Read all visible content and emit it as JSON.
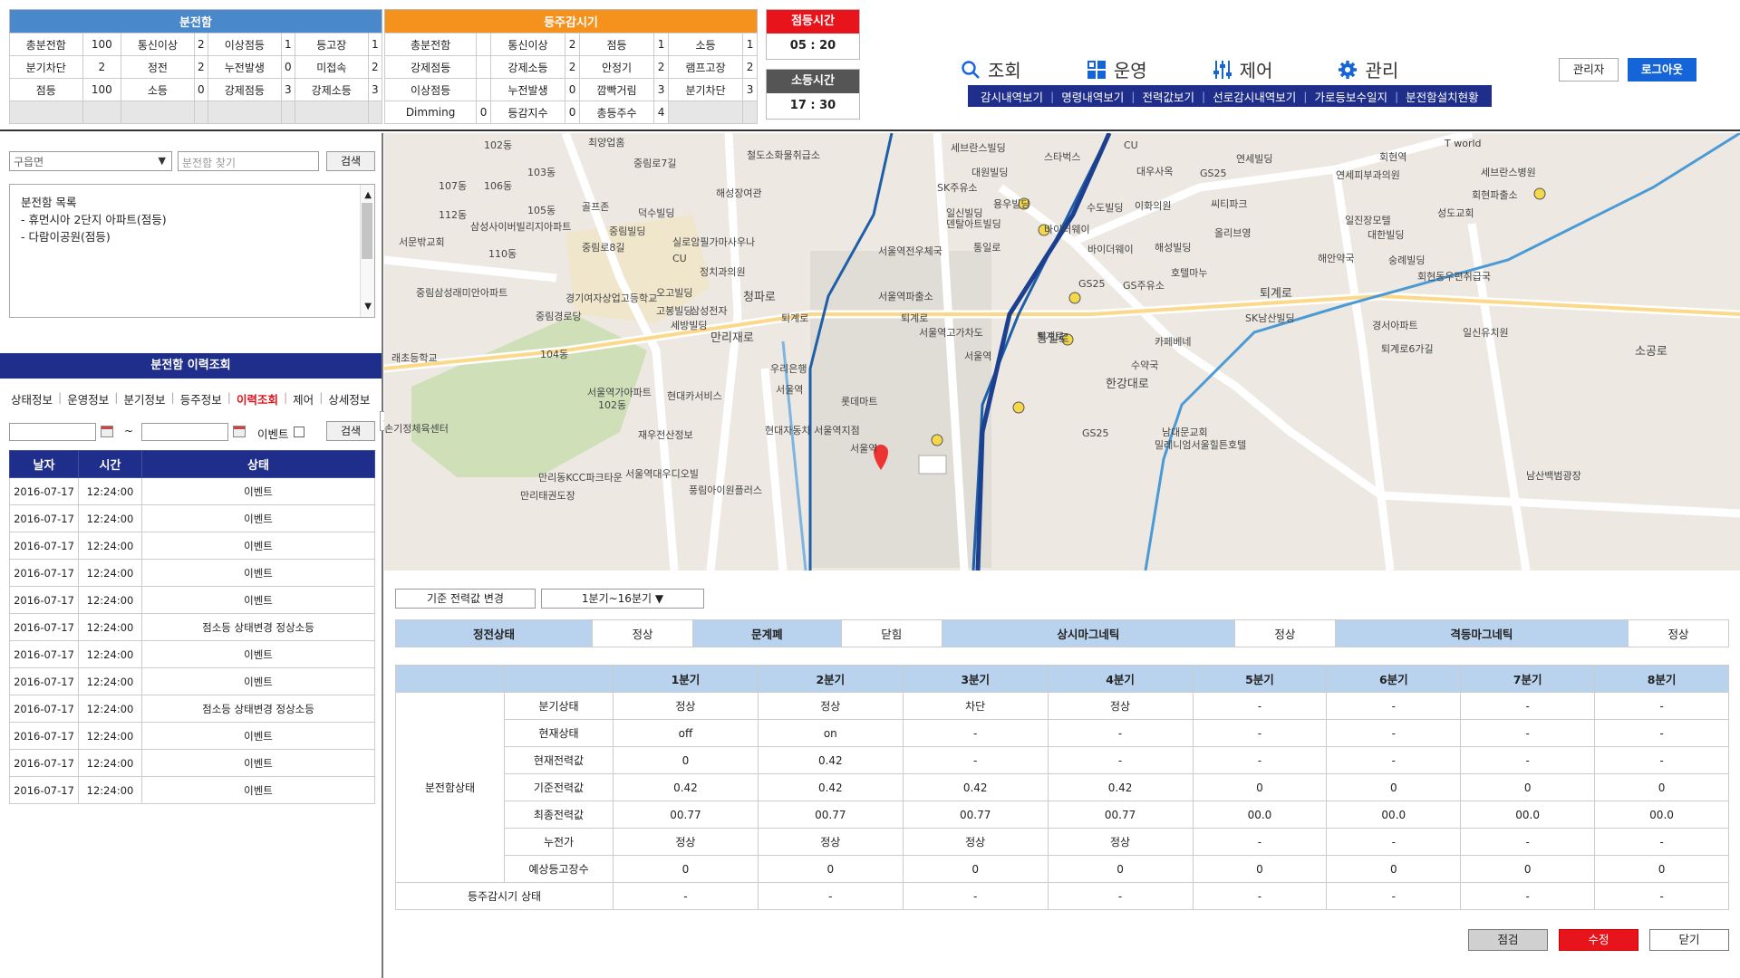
{
  "board_summary": {
    "title": "분전함",
    "rows": [
      [
        "총분전함",
        "100",
        "통신이상",
        "2",
        "이상점등",
        "1",
        "등고장",
        "1"
      ],
      [
        "분기차단",
        "2",
        "정전",
        "2",
        "누전발생",
        "0",
        "미접속",
        "2"
      ],
      [
        "점등",
        "100",
        "소등",
        "0",
        "강제점등",
        "3",
        "강제소등",
        "3"
      ],
      [
        "",
        "",
        "",
        "",
        "",
        "",
        "",
        ""
      ]
    ]
  },
  "monitor_summary": {
    "title": "등주감시기",
    "rows": [
      [
        "총분전함",
        "",
        "통신이상",
        "2",
        "점등",
        "1",
        "소등",
        "1"
      ],
      [
        "강제점등",
        "",
        "강제소등",
        "2",
        "안정기",
        "2",
        "램프고장",
        "2"
      ],
      [
        "이상점등",
        "",
        "누전발생",
        "0",
        "깜빡거림",
        "3",
        "분기차단",
        "3"
      ],
      [
        "Dimming",
        "0",
        "등감지수",
        "0",
        "총등주수",
        "4",
        "",
        ""
      ]
    ]
  },
  "on_time": {
    "label": "점등시간",
    "value": "05 : 20"
  },
  "off_time": {
    "label": "소등시간",
    "value": "17 : 30"
  },
  "nav": [
    {
      "label": "조회",
      "icon": "search-icon"
    },
    {
      "label": "운영",
      "icon": "grid-icon"
    },
    {
      "label": "제어",
      "icon": "sliders-icon"
    },
    {
      "label": "관리",
      "icon": "gear-icon"
    }
  ],
  "subnav": [
    "감시내역보기",
    "명령내역보기",
    "전력값보기",
    "선로감시내역보기",
    "가로등보수일지",
    "분전함설치현황"
  ],
  "admin_label": "관리자",
  "logout_label": "로그아웃",
  "left": {
    "district_placeholder": "구읍면",
    "search_placeholder": "분전함 찾기",
    "search_label": "검색",
    "list_title": "분전함 목록",
    "list_items": [
      "- 휴먼시아 2단지 아파트(점등)",
      "- 다람이공원(점등)"
    ],
    "history_title": "분전함 이력조회",
    "tabs": [
      "상태정보",
      "운영정보",
      "분기정보",
      "등주정보",
      "이력조회",
      "제어",
      "상세정보"
    ],
    "tilde": "~",
    "event_label": "이벤트",
    "history_search_label": "검색",
    "history_headers": [
      "날자",
      "시간",
      "상태"
    ],
    "history_rows": [
      [
        "2016-07-17",
        "12:24:00",
        "이벤트"
      ],
      [
        "2016-07-17",
        "12:24:00",
        "이벤트"
      ],
      [
        "2016-07-17",
        "12:24:00",
        "이벤트"
      ],
      [
        "2016-07-17",
        "12:24:00",
        "이벤트"
      ],
      [
        "2016-07-17",
        "12:24:00",
        "이벤트"
      ],
      [
        "2016-07-17",
        "12:24:00",
        "점소등 상태변경 정상소등"
      ],
      [
        "2016-07-17",
        "12:24:00",
        "이벤트"
      ],
      [
        "2016-07-17",
        "12:24:00",
        "이벤트"
      ],
      [
        "2016-07-17",
        "12:24:00",
        "점소등 상태변경 정상소등"
      ],
      [
        "2016-07-17",
        "12:24:00",
        "이벤트"
      ],
      [
        "2016-07-17",
        "12:24:00",
        "이벤트"
      ],
      [
        "2016-07-17",
        "12:24:00",
        "이벤트"
      ]
    ]
  },
  "map_labels": {
    "l1": "최양업홈",
    "l2": "철도소화물취급소",
    "l3": "세브란스빌딩",
    "l4": "스타벅스",
    "l5": "CU",
    "l6": "연세빌딩",
    "l7": "회현역",
    "l8": "T world",
    "l9": "세브란스병원",
    "l10": "102동",
    "l11": "103동",
    "l12": "중림로7길",
    "l13": "해성장여관",
    "l14": "대원빌딩",
    "l15": "SK주유소",
    "l16": "대우사옥",
    "l17": "GS25",
    "l18": "연세피부과의원",
    "l19": "세원면세점",
    "l20": "107동",
    "l21": "106동",
    "l22": "골프존",
    "l23": "덕수빌딩",
    "l24": "CU",
    "l25": "일신빌딩",
    "l26": "용우빌딩",
    "l27": "수도빌딩",
    "l28": "이화의원",
    "l29": "씨티파크",
    "l30": "회현파출소",
    "l31": "112동",
    "l32": "삼성사이버빌리지아파트",
    "l33": "105동",
    "l34": "중림빌딩",
    "l35": "실로암필가마사우나",
    "l36": "덴탈아트빌딩",
    "l37": "바이더웨이",
    "l38": "올리브영",
    "l39": "일진장모텔",
    "l40": "서문밖교회",
    "l41": "110동",
    "l42": "중림로8길",
    "l43": "서울역전우체국",
    "l44": "통일로",
    "l45": "바이더웨이",
    "l46": "해성빌딩",
    "l47": "대한빌딩",
    "l48": "성도교회",
    "l49": "CU",
    "l50": "정치과의원",
    "l51": "중림삼성래미안아파트",
    "l52": "경기여자상업고등학교",
    "l53": "오고빌딩",
    "l54": "서울역파출소",
    "l55": "GS25",
    "l56": "GS주유소",
    "l57": "호텔마누",
    "l58": "해안약국",
    "l59": "숭례빌딩",
    "l60": "회현동우편취급국",
    "l61": "중림경로당",
    "l62": "고봉빌딩",
    "l63": "삼성전자",
    "l64": "세방빌딩",
    "l65": "퇴계로",
    "l66": "퇴계로",
    "l67": "서울역고가차도",
    "l68": "SK남산빌딩",
    "l69": "경서아파트",
    "l70": "일신유치원",
    "l71": "래초등학교",
    "l72": "104동",
    "l73": "퇴계로",
    "l74": "카페베네",
    "l75": "서울역",
    "l76": "우리은행",
    "l77": "수약국",
    "l78": "퇴계로6가길",
    "l79": "서울역",
    "l80": "롯데마트",
    "l81": "서울역가아파트",
    "l82": "102동",
    "l83": "현대카서비스",
    "l84": "현대자동차 서울역지점",
    "l85": "손기정체육센터",
    "l86": "재우전산정보",
    "l87": "서울역",
    "l88": "GS25",
    "l89": "남대문교회",
    "l90": "밀레니엄서울힐튼호텔",
    "l91": "남산백범광장",
    "l92": "만리동KCC파크타운",
    "l93": "서울역대우디오빌",
    "l94": "풍림아이원플러스",
    "l95": "만리태권도장",
    "l96": "청파로",
    "l97": "만리재로",
    "l98": "통일로",
    "l99": "한강대로",
    "l100": "퇴계로",
    "l101": "소공로"
  },
  "bottom": {
    "ref_button": "기준 전력값 변경",
    "quarter_select": "1분기~16분기",
    "status_row": [
      "정전상태",
      "정상",
      "문계폐",
      "닫힘",
      "상시마그네틱",
      "정상",
      "격등마그네틱",
      "정상"
    ],
    "quarter_headers": [
      "",
      "",
      "1분기",
      "2분기",
      "3분기",
      "4분기",
      "5분기",
      "6분기",
      "7분기",
      "8분기"
    ],
    "group_label": "분전함상태",
    "rows": [
      {
        "label": "분기상태",
        "values": [
          "정상",
          "정상",
          "차단",
          "정상",
          "-",
          "-",
          "-",
          "-"
        ]
      },
      {
        "label": "현재상태",
        "values": [
          "off",
          "on",
          "-",
          "-",
          "-",
          "-",
          "-",
          "-"
        ]
      },
      {
        "label": "현재전력값",
        "values": [
          "0",
          "0.42",
          "-",
          "-",
          "-",
          "-",
          "-",
          "-"
        ]
      },
      {
        "label": "기준전력값",
        "values": [
          "0.42",
          "0.42",
          "0.42",
          "0.42",
          "0",
          "0",
          "0",
          "0"
        ]
      },
      {
        "label": "최종전력값",
        "values": [
          "00.77",
          "00.77",
          "00.77",
          "00.77",
          "00.0",
          "00.0",
          "00.0",
          "00.0"
        ]
      },
      {
        "label": "누전가",
        "values": [
          "정상",
          "정상",
          "정상",
          "정상",
          "-",
          "-",
          "-",
          "-"
        ]
      },
      {
        "label": "예상등고장수",
        "values": [
          "0",
          "0",
          "0",
          "0",
          "0",
          "0",
          "0",
          "0"
        ]
      }
    ],
    "monitor_label": "등주감시기 상태",
    "monitor_values": [
      "-",
      "-",
      "-",
      "-",
      "-",
      "-",
      "-",
      "-"
    ],
    "check_label": "점검",
    "edit_label": "수정",
    "close_label": "닫기"
  }
}
